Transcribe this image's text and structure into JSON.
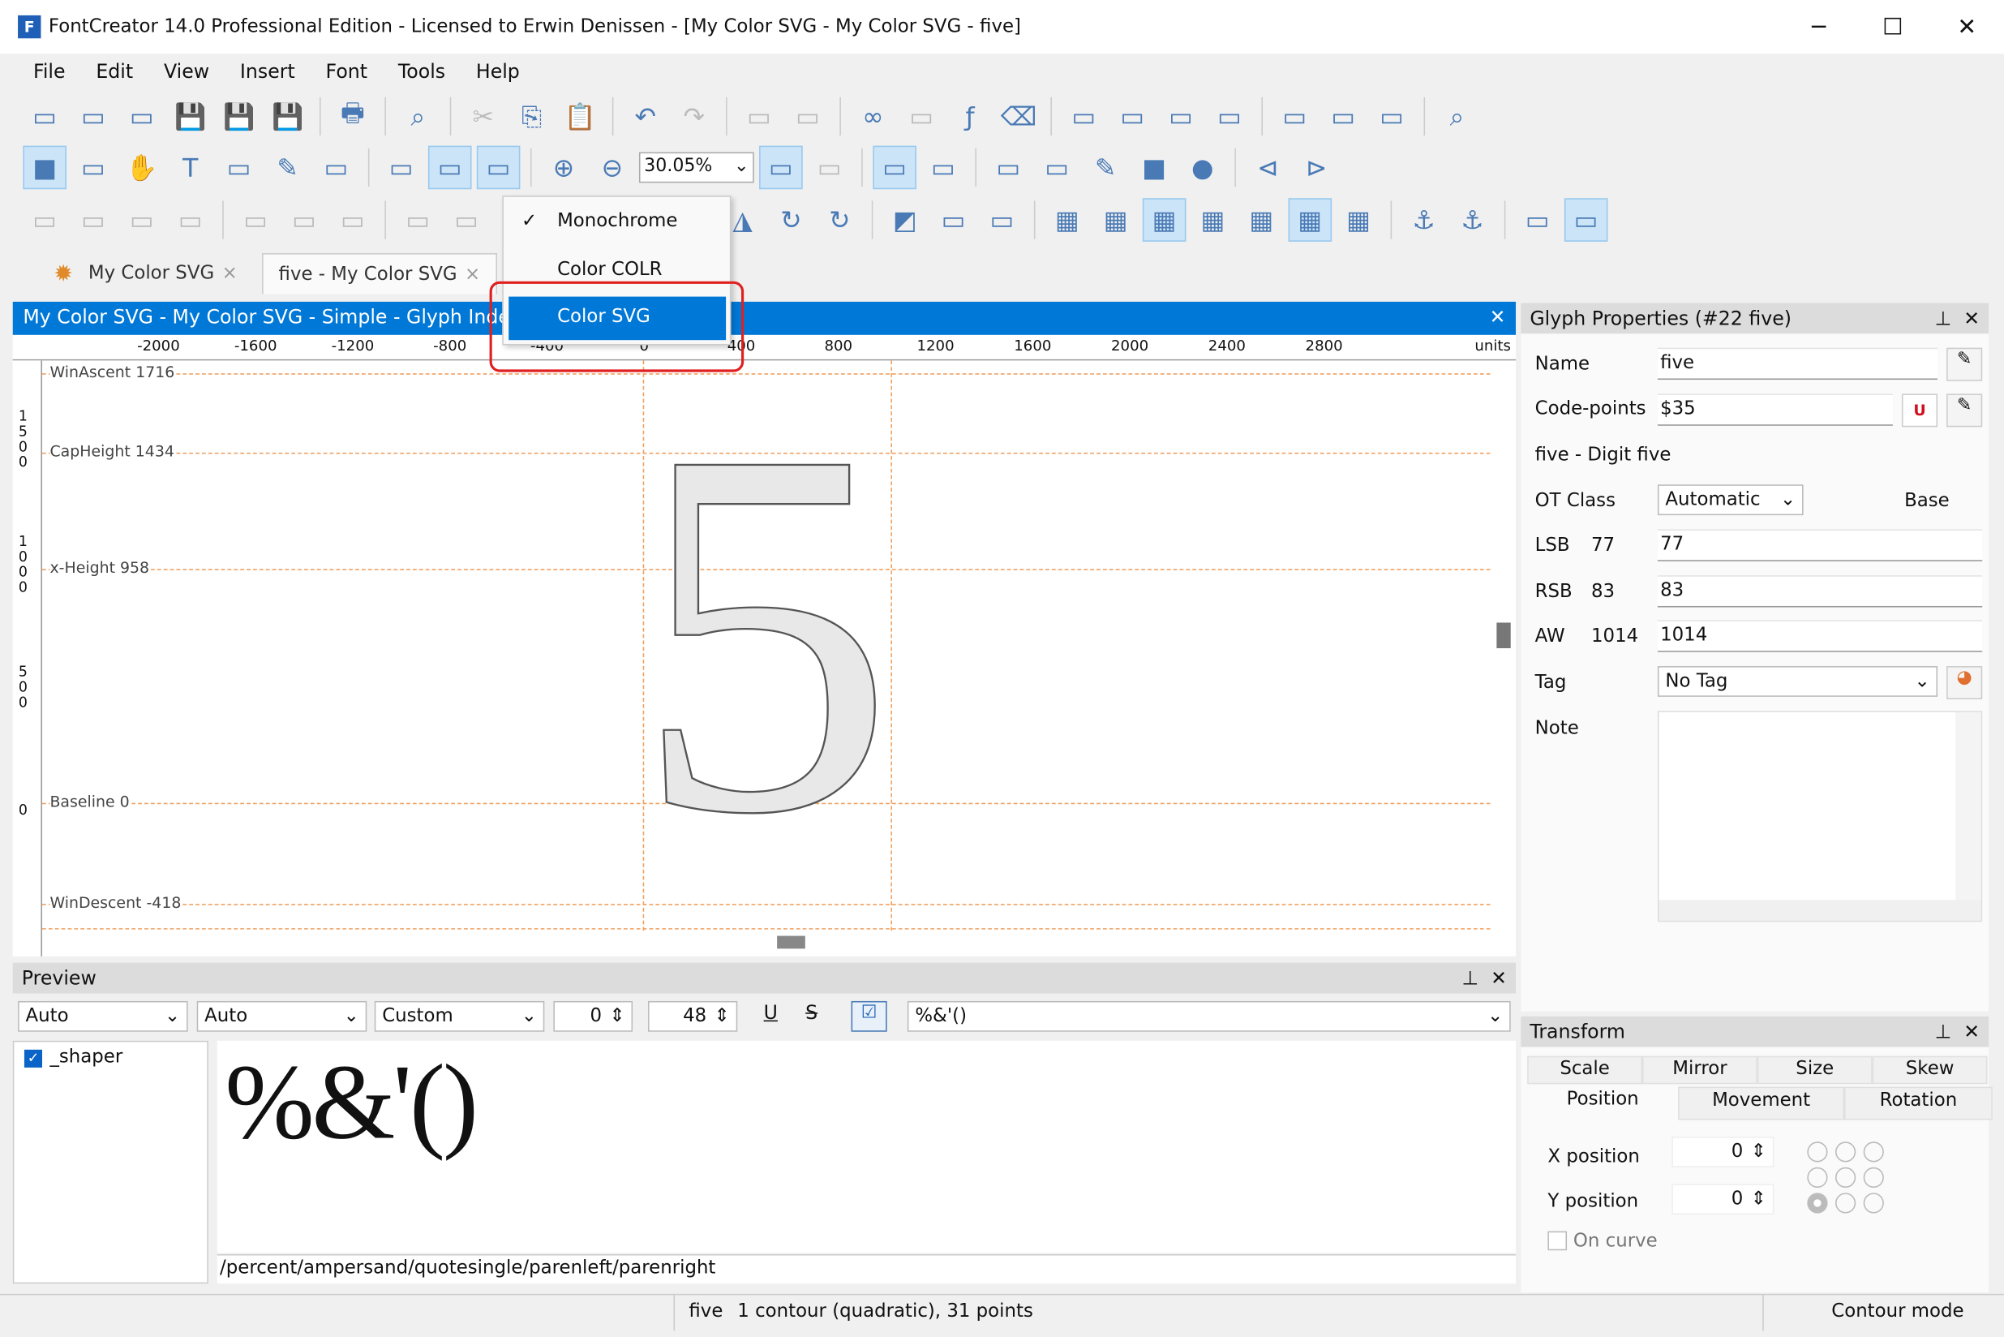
{
  "window": {
    "title": "FontCreator 14.0 Professional Edition - Licensed to Erwin Denissen - [My Color SVG - My Color SVG - five]",
    "minimize": "─",
    "maximize": "☐",
    "close": "✕"
  },
  "menu": [
    "File",
    "Edit",
    "View",
    "Insert",
    "Font",
    "Tools",
    "Help"
  ],
  "toolbar": {
    "row1": [
      "new-font-icon",
      "open-icon",
      "font-overview-icon",
      "save-icon",
      "save-all-icon",
      "save-as-icon",
      "|",
      "print-icon",
      "|",
      "find-icon",
      "|",
      "cut-icon",
      "copy-icon",
      "paste-icon",
      "|",
      "undo-icon",
      "redo-icon",
      "|",
      "insert-codepoint-icon",
      "insert-glyph-icon",
      "|",
      "link-icon",
      "unlink-icon",
      "formula-icon",
      "eraser-icon",
      "|",
      "test-icon",
      "edit-icon",
      "transform-icon",
      "validate-icon",
      "|",
      "spell-icon",
      "spell-web-icon",
      "preview-icon",
      "|",
      "find-glyph-icon"
    ],
    "row2": [
      "rectangle-select-icon",
      "lasso-icon",
      "hand-icon",
      "text-icon",
      "measure-icon",
      "pen-icon",
      "fill-icon",
      "|",
      "image-icon",
      "fill-mode-icon",
      "color-mode-icon",
      "|",
      "zoom-in-icon",
      "zoom-out-icon",
      "ZOOM",
      "fit-icon",
      "zoom-region-icon",
      "|",
      "contour-icon",
      "points-icon",
      "|",
      "add-image-icon",
      "brush-icon",
      "pencil-icon",
      "rectangle-icon",
      "ellipse-icon",
      "|",
      "previous-icon",
      "next-icon"
    ],
    "row3": [
      "align-icon",
      "align2-icon",
      "align3-icon",
      "align4-icon",
      "|",
      "align-left-icon",
      "align-center-icon",
      "align-right-icon",
      "|",
      "align-top-icon",
      "align-middle-icon",
      "align-bottom-icon",
      "|",
      "rotate-icon",
      "clamp-icon",
      "|",
      "flip-h-icon",
      "flip-v-icon",
      "rotate-left-icon",
      "rotate-right-icon",
      "|",
      "union-icon",
      "intersect-icon",
      "subtract-icon",
      "|",
      "grid-icon",
      "grid2-icon",
      "grid3-icon",
      "grid4-icon",
      "grid5-icon",
      "grid6-icon",
      "grid7-icon",
      "|",
      "anchor-icon",
      "anchor-lock-icon",
      "|",
      "node-icon",
      "glyph-box-icon"
    ],
    "zoom_value": "30.05%"
  },
  "tabs": [
    {
      "label": "My Color SVG",
      "close": "×"
    },
    {
      "label": "five - My Color SVG",
      "close": "×"
    }
  ],
  "editor": {
    "header": "My Color SVG - My Color SVG - Simple - Glyph Index: 2",
    "close": "✕",
    "ruler": [
      "-2000",
      "-1600",
      "-1200",
      "-800",
      "-400",
      "0",
      "400",
      "800",
      "1200",
      "1600",
      "2000",
      "2400",
      "2800"
    ],
    "units": "units",
    "vruler": [
      "1500",
      "1000",
      "500",
      "0"
    ],
    "guides": [
      "WinAscent 1716",
      "CapHeight 1434",
      "x-Height 958",
      "Baseline 0",
      "WinDescent -418"
    ],
    "glyph": "5",
    "guide_color": "#f0a060"
  },
  "render_menu": {
    "items": [
      {
        "label": "Monochrome",
        "checked": true
      },
      {
        "label": "Color COLR",
        "checked": false
      },
      {
        "label": "Color SVG",
        "checked": false,
        "highlighted": true
      }
    ],
    "check": "✓",
    "highlight_color": "#0078d7",
    "annotation_color": "#e02020"
  },
  "preview": {
    "title": "Preview",
    "pin": "📌",
    "close": "✕",
    "sel1": "Auto",
    "sel2": "Auto",
    "sel3": "Custom",
    "num1": "0",
    "num2": "48",
    "underline": "U",
    "strike": "S",
    "text": "%&'()",
    "shaper": "_shaper",
    "path": "/percent/ampersand/quotesingle/parenleft/parenright"
  },
  "props": {
    "title": "Glyph Properties (#22 five)",
    "name_label": "Name",
    "name": "five",
    "cp_label": "Code-points",
    "cp": "$35",
    "desc": "five - Digit five",
    "ot_label": "OT Class",
    "ot": "Automatic",
    "base": "Base",
    "lsb_label": "LSB",
    "lsb": "77",
    "rsb_label": "RSB",
    "rsb": "83",
    "aw_label": "AW",
    "aw": "1014",
    "tag_label": "Tag",
    "tag": "No Tag",
    "note_label": "Note"
  },
  "transform": {
    "title": "Transform",
    "tabs1": [
      "Scale",
      "Mirror",
      "Size",
      "Skew"
    ],
    "tabs2": [
      "Position",
      "Movement",
      "Rotation"
    ],
    "x_label": "X position",
    "x": "0",
    "y_label": "Y position",
    "y": "0",
    "on_curve": "On curve"
  },
  "status": {
    "glyph": "five",
    "info": "1 contour (quadratic), 31 points",
    "mode": "Contour mode"
  }
}
